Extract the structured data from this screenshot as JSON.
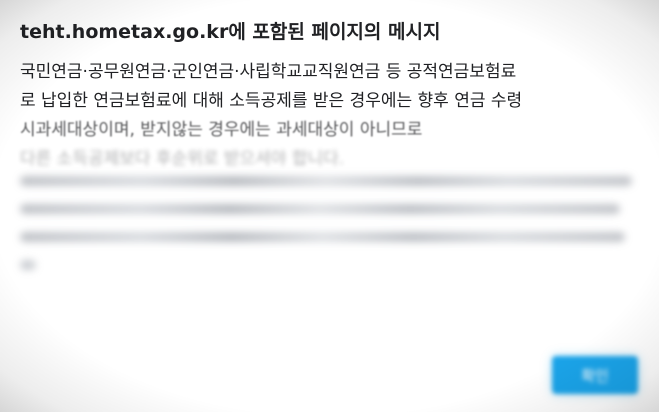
{
  "dialog": {
    "title": "teht.hometax.go.kr에 포함된 페이지의 메시지",
    "message_lines": [
      "국민연금·공무원연금·군인연금·사립학교교직원연금 등 공적연금보험료",
      "로 납입한 연금보험료에 대해 소득공제를 받은 경우에는 향후 연금 수령",
      "시과세대상이며, 받지않는 경우에는 과세대상이 아니므로",
      "다른 소득공제보다 후순위로 받으셔야 합니다."
    ],
    "ok_label": "확인"
  },
  "colors": {
    "button_bg": "#1aa3e8",
    "text": "#202124",
    "dialog_bg": "#ffffff"
  }
}
